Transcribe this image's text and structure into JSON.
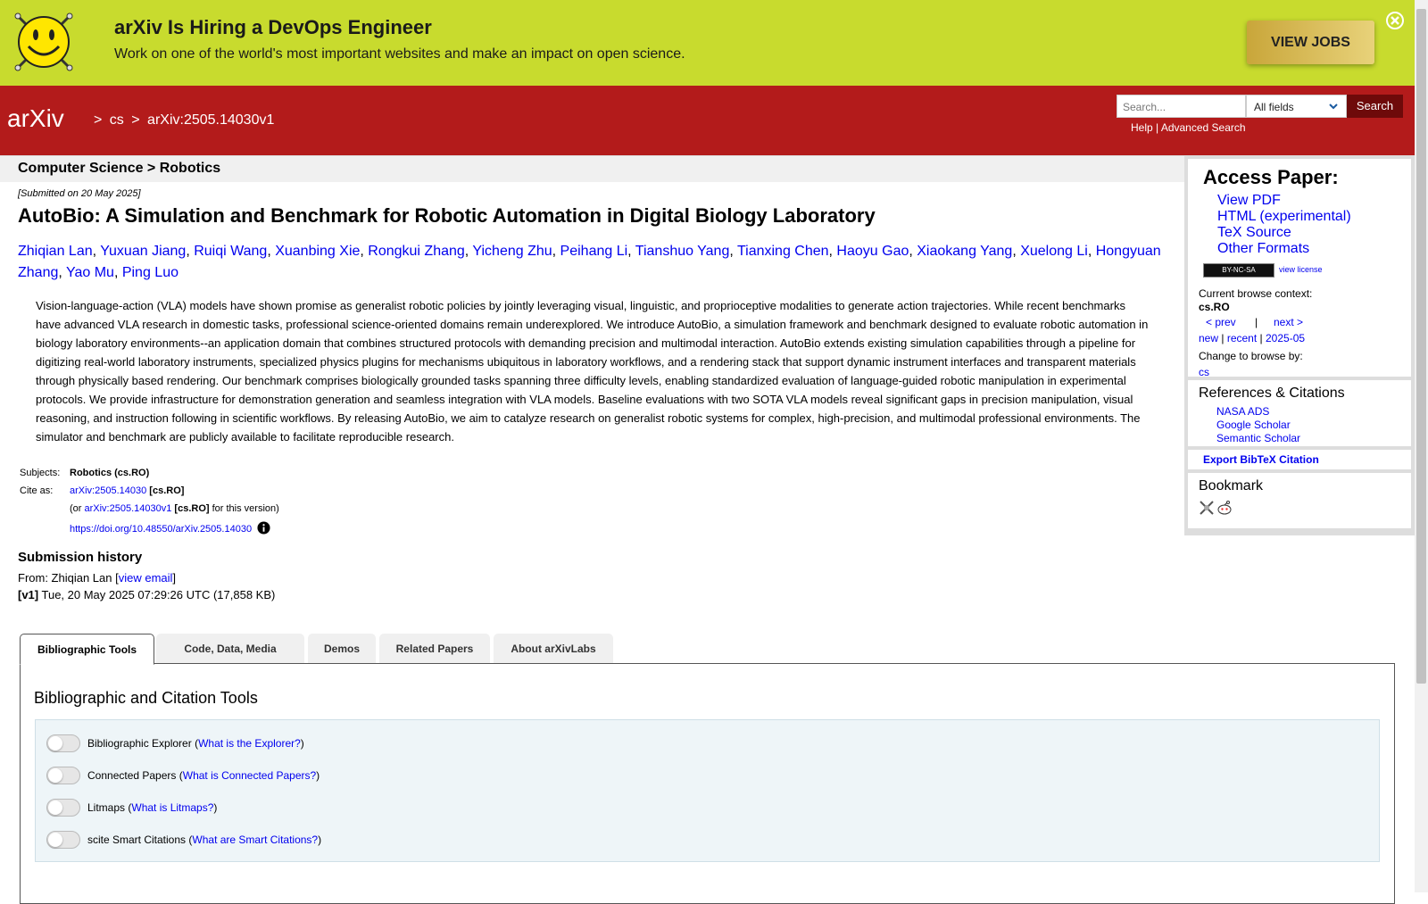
{
  "banner": {
    "title": "arXiv Is Hiring a DevOps Engineer",
    "subtitle": "Work on one of the world's most important websites and make an impact on open science.",
    "button_label": "VIEW JOBS",
    "accent_color": "#c8db2e"
  },
  "header": {
    "logo_text": "arXiv",
    "breadcrumb": [
      ">",
      "cs",
      ">",
      "arXiv:2505.14030v1"
    ],
    "search_placeholder": "Search...",
    "search_field_selected": "All fields",
    "search_button": "Search",
    "help_link": "Help",
    "separator": "|",
    "advanced_link": "Advanced Search",
    "brand_color": "#b31b1b"
  },
  "subject_bar": "Computer Science > Robotics",
  "submitted": "[Submitted on 20 May 2025]",
  "title": "AutoBio: A Simulation and Benchmark for Robotic Automation in Digital Biology Laboratory",
  "authors": [
    "Zhiqian Lan",
    "Yuxuan Jiang",
    "Ruiqi Wang",
    "Xuanbing Xie",
    "Rongkui Zhang",
    "Yicheng Zhu",
    "Peihang Li",
    "Tianshuo Yang",
    "Tianxing Chen",
    "Haoyu Gao",
    "Xiaokang Yang",
    "Xuelong Li",
    "Hongyuan Zhang",
    "Yao Mu",
    "Ping Luo"
  ],
  "abstract": "Vision-language-action (VLA) models have shown promise as generalist robotic policies by jointly leveraging visual, linguistic, and proprioceptive modalities to generate action trajectories. While recent benchmarks have advanced VLA research in domestic tasks, professional science-oriented domains remain underexplored. We introduce AutoBio, a simulation framework and benchmark designed to evaluate robotic automation in biology laboratory environments--an application domain that combines structured protocols with demanding precision and multimodal interaction. AutoBio extends existing simulation capabilities through a pipeline for digitizing real-world laboratory instruments, specialized physics plugins for mechanisms ubiquitous in laboratory workflows, and a rendering stack that support dynamic instrument interfaces and transparent materials through physically based rendering. Our benchmark comprises biologically grounded tasks spanning three difficulty levels, enabling standardized evaluation of language-guided robotic manipulation in experimental protocols. We provide infrastructure for demonstration generation and seamless integration with VLA models. Baseline evaluations with two SOTA VLA models reveal significant gaps in precision manipulation, visual reasoning, and instruction following in scientific workflows. By releasing AutoBio, we aim to catalyze research on generalist robotic systems for complex, high-precision, and multimodal professional environments. The simulator and benchmark are publicly available to facilitate reproducible research.",
  "meta": {
    "subjects_label": "Subjects:",
    "subjects_value": "Robotics (cs.RO)",
    "cite_label": "Cite as:",
    "cite_link": "arXiv:2505.14030",
    "cite_tag": "[cs.RO]",
    "version_prefix": "(or ",
    "version_link": "arXiv:2505.14030v1",
    "version_tag": "[cs.RO]",
    "version_suffix": " for this version)",
    "doi": "https://doi.org/10.48550/arXiv.2505.14030"
  },
  "history": {
    "title": "Submission history",
    "from_prefix": "From: Zhiqian Lan [",
    "view_email": "view email",
    "from_suffix": "]",
    "v1_label": "[v1]",
    "v1_text": " Tue, 20 May 2025 07:29:26 UTC (17,858 KB)"
  },
  "tabs": [
    "Bibliographic Tools",
    "Code, Data, Media",
    "Demos",
    "Related Papers",
    "About arXivLabs"
  ],
  "tools_panel": {
    "title": "Bibliographic and Citation Tools",
    "tools": [
      {
        "name": "Bibliographic Explorer",
        "link": "What is the Explorer?"
      },
      {
        "name": "Connected Papers",
        "link": "What is Connected Papers?"
      },
      {
        "name": "Litmaps",
        "link": "What is Litmaps?"
      },
      {
        "name": "scite Smart Citations",
        "link": "What are Smart Citations?"
      }
    ]
  },
  "sidebar": {
    "access_title": "Access Paper:",
    "access_links": [
      "View PDF",
      "HTML (experimental)",
      "TeX Source",
      "Other Formats"
    ],
    "license_badge": "BY-NC-SA",
    "view_license": "view license",
    "context_label": "Current browse context:",
    "context_value": "cs.RO",
    "prev": "< prev",
    "pipe": "|",
    "next": "next >",
    "new": "new",
    "recent": "recent",
    "month": "2025-05",
    "change_label": "Change to browse by:",
    "change_value": "cs",
    "refs_title": "References & Citations",
    "refs_links": [
      "NASA ADS",
      "Google Scholar",
      "Semantic Scholar"
    ],
    "export": "Export BibTeX Citation",
    "bookmark_title": "Bookmark"
  }
}
